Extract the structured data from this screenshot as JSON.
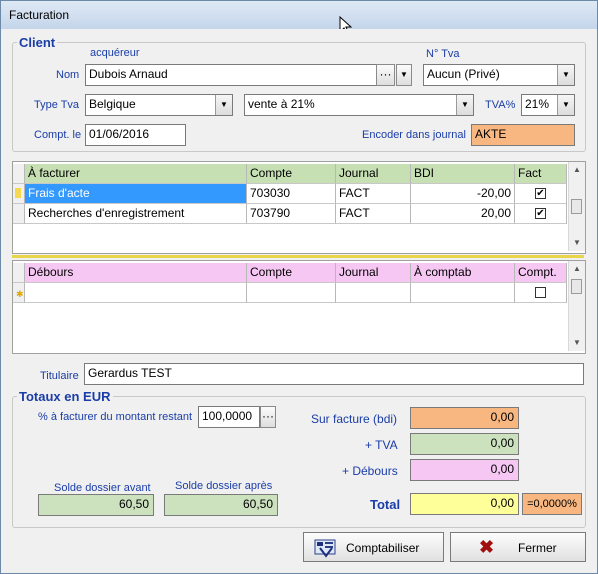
{
  "window": {
    "title": "Facturation"
  },
  "client": {
    "group_title": "Client",
    "acquereur_label": "acquéreur",
    "nom_label": "Nom",
    "nom_value": "Dubois Arnaud",
    "ellipsis": "···",
    "ntva_label": "N° Tva",
    "ntva_value": "Aucun (Privé)",
    "typetva_label": "Type Tva",
    "typetva_value": "Belgique",
    "vente_value": "vente à 21%",
    "tvapct_label": "TVA%",
    "tvapct_value": "21%",
    "compt_label": "Compt. le",
    "compt_value": "01/06/2016",
    "journal_label": "Encoder dans journal",
    "journal_value": "AKTE",
    "journal_color": "#f8b780"
  },
  "afacturer": {
    "headers": [
      "À facturer",
      "Compte",
      "Journal",
      "BDI",
      "Fact"
    ],
    "rows": [
      {
        "label": "Frais d'acte",
        "compte": "703030",
        "journal": "FACT",
        "bdi": "-20,00",
        "fact": true,
        "selected": true
      },
      {
        "label": "Recherches d'enregistrement",
        "compte": "703790",
        "journal": "FACT",
        "bdi": "20,00",
        "fact": true,
        "selected": false
      }
    ]
  },
  "debours": {
    "headers": [
      "Débours",
      "Compte",
      "Journal",
      "À comptab",
      "Compt."
    ],
    "rows": [
      {
        "compt": false
      }
    ]
  },
  "titulaire": {
    "label": "Titulaire",
    "value": "Gerardus TEST"
  },
  "totaux": {
    "group_title": "Totaux en EUR",
    "pct_label": "% à facturer du montant restant",
    "pct_value": "100,0000",
    "ellipsis": "···",
    "sur_facture_label": "Sur facture (bdi)",
    "sur_facture_value": "0,00",
    "tva_label": "+ TVA",
    "tva_value": "0,00",
    "debours_label": "+ Débours",
    "debours_value": "0,00",
    "solde_avant_label": "Solde dossier avant",
    "solde_avant_value": "60,50",
    "solde_apres_label": "Solde dossier après",
    "solde_apres_value": "60,50",
    "total_label": "Total",
    "total_value": "0,00",
    "total_pct": "=0,0000%"
  },
  "buttons": {
    "comptabiliser": "Comptabiliser",
    "fermer": "Fermer"
  },
  "colors": {
    "accent_blue": "#1a3da8",
    "orange": "#f8b780",
    "green": "#cce2bf",
    "pink": "#f7c7f4",
    "yellow": "#ffff99",
    "grid_header_green": "#c6e0b4",
    "grid_header_pink": "#f7c7f4",
    "selected_row": "#3399ff"
  }
}
